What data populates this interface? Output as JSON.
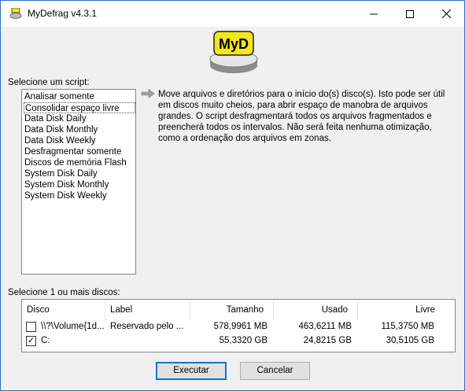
{
  "window": {
    "title": "MyDefrag v4.3.1"
  },
  "logo": {
    "text": "MyD"
  },
  "scripts": {
    "label": "Selecione um script:",
    "items": [
      "Analisar somente",
      "Consolidar espaço livre",
      "Data Disk Daily",
      "Data Disk Monthly",
      "Data Disk Weekly",
      "Desfragmentar somente",
      "Discos de memória Flash",
      "System Disk Daily",
      "System Disk Monthly",
      "System Disk Weekly"
    ],
    "selected_index": 1
  },
  "description": "Move arquivos e diretórios para o início do(s) disco(s). Isto pode ser útil em discos muito cheios, para abrir espaço de manobra de arquivos grandes. O script desfragmentará todos os arquivos fragmentados e preencherá todos os intervalos. Não será feita nenhuma otimização, como a ordenação dos arquivos em zonas.",
  "disks": {
    "label": "Selecione 1 ou mais discos:",
    "columns": [
      "Disco",
      "Label",
      "Tamanho",
      "Usado",
      "Livre"
    ],
    "rows": [
      {
        "checked": false,
        "disk": "\\\\?\\Volume{1d...",
        "label": "Reservado pelo ...",
        "size": "578,9961 MB",
        "used": "463,6211 MB",
        "free": "115,3750 MB"
      },
      {
        "checked": true,
        "disk": "C:",
        "label": "",
        "size": "55,3320 GB",
        "used": "24,8215 GB",
        "free": "30,5105 GB"
      }
    ]
  },
  "buttons": {
    "execute": "Executar",
    "cancel": "Cancelar"
  },
  "colors": {
    "accent": "#0078d7",
    "logo_yellow": "#f5e61b"
  }
}
